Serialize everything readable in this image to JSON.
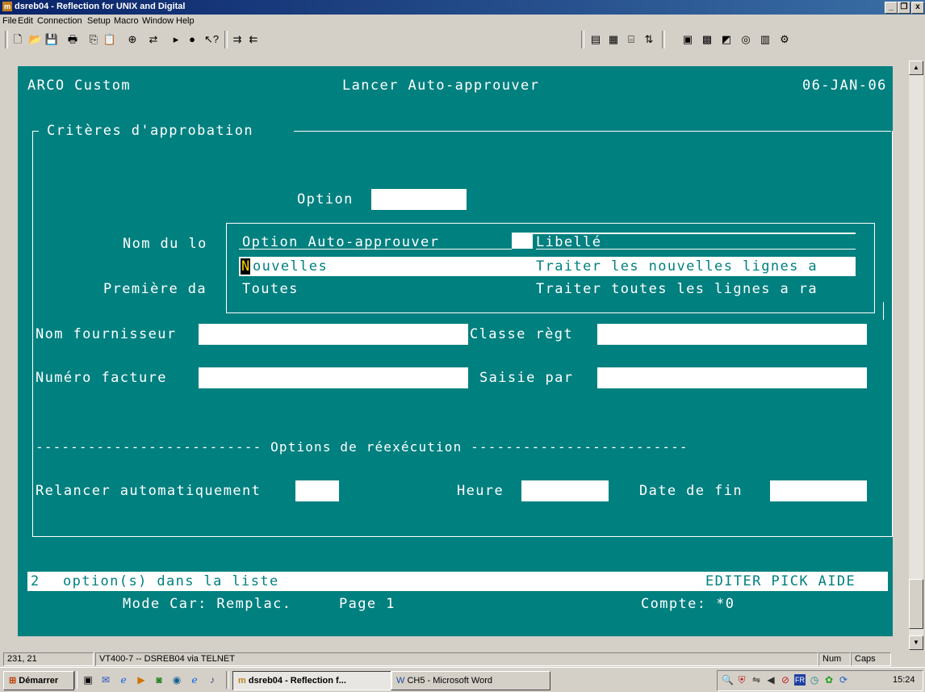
{
  "window": {
    "title": "dsreb04 - Reflection for UNIX and Digital",
    "app_icon": "reflection-icon",
    "controls": [
      "_",
      "ⓑ",
      "x"
    ]
  },
  "menu": [
    "File",
    "Edit",
    "Connection",
    "Setup",
    "Macro",
    "Window",
    "Help"
  ],
  "toolbar": {
    "left_icons": [
      "new-document-icon",
      "open-folder-icon",
      "save-icon",
      "print-icon",
      "copy-icon",
      "paste-icon",
      "connect-icon",
      "disconnect-icon",
      "play-macro-icon",
      "record-macro-icon",
      "context-help-icon",
      "send-icon",
      "receive-icon"
    ],
    "right_icons": [
      "keyboard-map-icon",
      "display-setup-icon",
      "terminal-setup-icon",
      "file-transfer-icon",
      "hotspot-icon",
      "color-setup-icon",
      "mouse-map-icon",
      "event-icon",
      "toolbar-setup-icon",
      "settings-icon"
    ]
  },
  "terminal": {
    "header_left": "ARCO Custom",
    "header_center": "Lancer Auto-approuver",
    "header_date": "06-JAN-06",
    "section_title": "Critères d'approbation",
    "option_label": "Option",
    "name_label": "Nom du lo",
    "first_date_label": "Première da",
    "popup": {
      "col1_header": "Option Auto-approuver",
      "col2_header": "Libellé",
      "rows": [
        {
          "option": "Nouvelles",
          "cursor": "N",
          "rest": "ouvelles",
          "label": "Traiter les nouvelles lignes a"
        },
        {
          "option": "Toutes",
          "label": "Traiter toutes les lignes a ra"
        }
      ]
    },
    "supplier_label": "Nom fournisseur",
    "pay_class_label": "Classe règt",
    "invoice_label": "Numéro facture",
    "entered_by_label": "Saisie par",
    "rerun_separator": "-------------------------- Options de réexécution -------------------------",
    "auto_rerun_label": "Relancer automatiquement",
    "time_label": "Heure",
    "end_date_label": "Date de fin",
    "status_count": "2",
    "status_text": "option(s) dans la liste",
    "status_keys": "EDITER PICK AIDE",
    "mode_text": "Mode Car: Remplac.",
    "page_text": "Page 1",
    "count_text": "Compte: *0"
  },
  "statusbar": {
    "cursor_pos": "231, 21",
    "connection": "VT400-7 -- DSREB04 via TELNET",
    "num": "Num",
    "caps": "Caps"
  },
  "taskbar": {
    "start": "Démarrer",
    "quick_launch": [
      "show-desktop-icon",
      "outlook-icon",
      "ie-icon",
      "media-icon",
      "app-icon",
      "netscape-icon",
      "browser-icon",
      "winamp-icon"
    ],
    "tasks": [
      {
        "label": "dsreb04 - Reflection f...",
        "active": true
      },
      {
        "label": "CH5 - Microsoft Word",
        "active": false
      }
    ],
    "tray_icons": [
      "search-icon",
      "shield-icon",
      "network-icon",
      "volume-icon",
      "antivirus-icon",
      "language-fr-icon",
      "clock-icon",
      "messenger-icon",
      "sync-icon"
    ],
    "clock": "15:24"
  }
}
